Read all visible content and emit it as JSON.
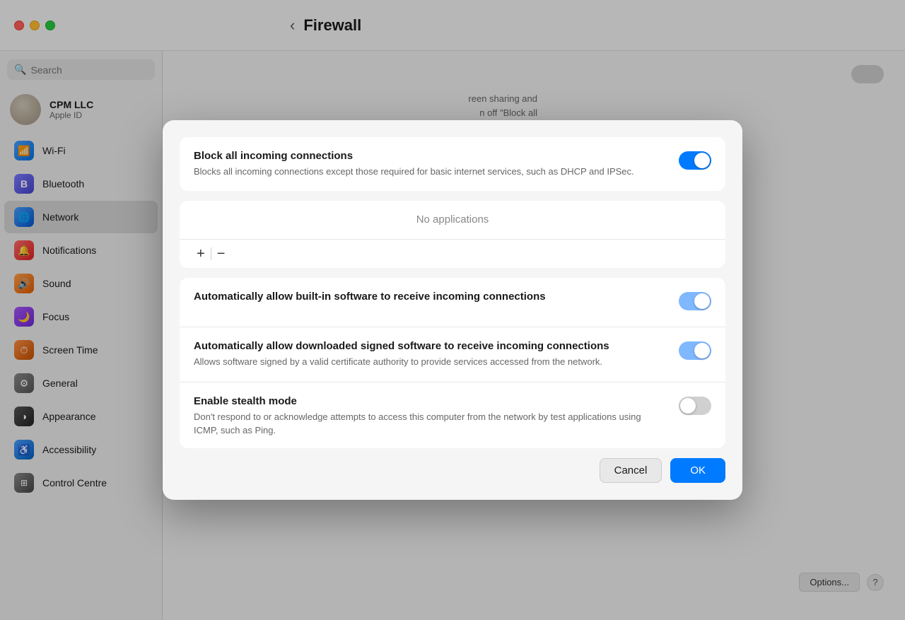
{
  "window": {
    "title": "Firewall",
    "traffic_lights": {
      "close": "close",
      "minimize": "minimize",
      "maximize": "maximize"
    }
  },
  "sidebar": {
    "search_placeholder": "Search",
    "user": {
      "name": "CPM LLC",
      "subtitle": "Apple ID"
    },
    "items": [
      {
        "id": "wifi",
        "label": "Wi-Fi",
        "icon_class": "icon-wifi",
        "icon_char": "📶",
        "active": false
      },
      {
        "id": "bluetooth",
        "label": "Bluetooth",
        "icon_class": "icon-bluetooth",
        "icon_char": "✦",
        "active": false
      },
      {
        "id": "network",
        "label": "Network",
        "icon_class": "icon-network",
        "icon_char": "🌐",
        "active": true
      },
      {
        "id": "notifications",
        "label": "Notifications",
        "icon_class": "icon-notifications",
        "icon_char": "🔔",
        "active": false
      },
      {
        "id": "sound",
        "label": "Sound",
        "icon_class": "icon-sound",
        "icon_char": "🔊",
        "active": false
      },
      {
        "id": "focus",
        "label": "Focus",
        "icon_class": "icon-focus",
        "icon_char": "🌙",
        "active": false
      },
      {
        "id": "screen-time",
        "label": "Screen Time",
        "icon_class": "icon-screentime",
        "icon_char": "⏱",
        "active": false
      },
      {
        "id": "general",
        "label": "General",
        "icon_class": "icon-general",
        "icon_char": "⚙",
        "active": false
      },
      {
        "id": "appearance",
        "label": "Appearance",
        "icon_class": "icon-appearance",
        "icon_char": "◑",
        "active": false
      },
      {
        "id": "accessibility",
        "label": "Accessibility",
        "icon_class": "icon-accessibility",
        "icon_char": "♿",
        "active": false
      },
      {
        "id": "control-centre",
        "label": "Control Centre",
        "icon_class": "icon-controlcentre",
        "icon_char": "⊞",
        "active": false
      }
    ]
  },
  "background": {
    "description_line1": "reen sharing and",
    "description_line2": "n off \"Block all",
    "options_label": "Options...",
    "help_label": "?"
  },
  "modal": {
    "sections": [
      {
        "id": "block-all",
        "rows": [
          {
            "title": "Block all incoming connections",
            "description": "Blocks all incoming connections except those required for basic internet services, such as DHCP and IPSec.",
            "toggle_state": "on",
            "has_toggle": true
          }
        ]
      },
      {
        "id": "no-applications",
        "no_apps_text": "No applications",
        "add_label": "+",
        "remove_label": "−"
      },
      {
        "id": "auto-settings",
        "rows": [
          {
            "title": "Automatically allow built-in software to receive incoming connections",
            "description": "",
            "toggle_state": "on-faded",
            "has_toggle": true
          },
          {
            "title": "Automatically allow downloaded signed software to receive incoming connections",
            "description": "Allows software signed by a valid certificate authority to provide services accessed from the network.",
            "toggle_state": "on-faded",
            "has_toggle": true
          },
          {
            "title": "Enable stealth mode",
            "description": "Don't respond to or acknowledge attempts to access this computer from the network by test applications using ICMP, such as Ping.",
            "toggle_state": "off",
            "has_toggle": true
          }
        ]
      }
    ],
    "cancel_label": "Cancel",
    "ok_label": "OK"
  }
}
